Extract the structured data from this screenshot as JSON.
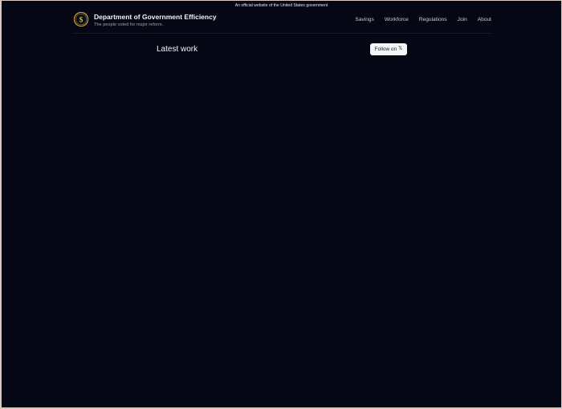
{
  "banner": {
    "text": "An official website of the United States government"
  },
  "header": {
    "title": "Department of Government Efficiency",
    "tagline": "The people voted for major reform.",
    "seal_icon": "dollar-seal-icon",
    "accent_color": "#c9a24a"
  },
  "nav": {
    "items": [
      "Savings",
      "Workforce",
      "Regulations",
      "Join",
      "About"
    ]
  },
  "main": {
    "section_title": "Latest work",
    "follow_label": "Follow on",
    "follow_icon": "x-logo-icon",
    "follow_glyph": "𝕏"
  },
  "colors": {
    "background": "#050814",
    "text": "#f3f4f6",
    "muted_text": "#9aa0ab",
    "button_bg": "#f4f5f7",
    "button_text": "#111318"
  }
}
